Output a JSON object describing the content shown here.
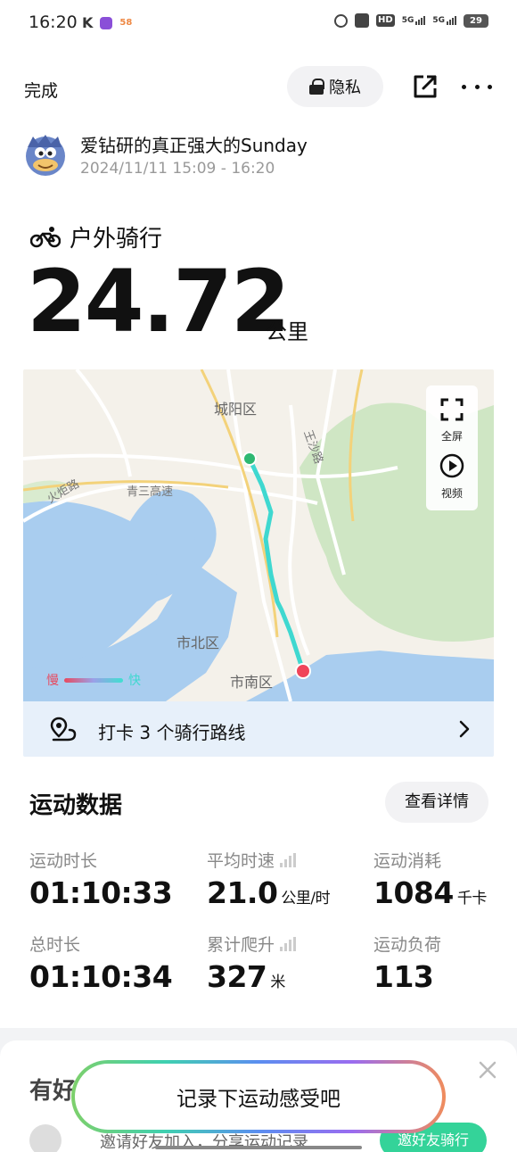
{
  "status_bar": {
    "time": "16:20",
    "left_icons": [
      "k-icon",
      "app-icon-1",
      "app-icon-2"
    ],
    "right_icons": [
      "alarm-icon",
      "id-icon",
      "hd-icon",
      "signal-5g-icon",
      "signal-5g-icon"
    ],
    "hd_label": "HD",
    "net1": "5G",
    "net2": "5G",
    "battery": "29"
  },
  "header": {
    "done_label": "完成",
    "privacy_label": "隐私",
    "share_icon": "share-icon",
    "more_icon": "more-icon"
  },
  "user": {
    "name": "爱钻研的真正强大的Sunday",
    "datetime": "2024/11/11 15:09 - 16:20",
    "avatar_icon": "avatar-icon"
  },
  "activity": {
    "type_icon": "bike-icon",
    "type_label": "户外骑行",
    "distance": "24.72",
    "distance_unit": "公里"
  },
  "map": {
    "labels": {
      "chengyang": "城阳区",
      "wangsha": "王沙路",
      "huoju": "火炬路",
      "qingsan": "青三高速",
      "shibei": "市北区",
      "shinan": "市南区"
    },
    "fullscreen_label": "全屏",
    "video_label": "视频",
    "legend_slow": "慢",
    "legend_fast": "快",
    "route_text": "打卡 3 个骑行路线",
    "colors": {
      "water": "#a9cdef",
      "land": "#f4f1ea",
      "green": "#cfe6c4",
      "route": "#3fd8d0",
      "start": "#2eb872",
      "end": "#f0455a"
    }
  },
  "stats": {
    "title": "运动数据",
    "detail_label": "查看详情",
    "items": [
      {
        "label": "运动时长",
        "value": "01:10:33",
        "unit": ""
      },
      {
        "label": "平均时速",
        "value": "21.0",
        "unit": "公里/时"
      },
      {
        "label": "运动消耗",
        "value": "1084",
        "unit": "千卡"
      },
      {
        "label": "总时长",
        "value": "01:10:34",
        "unit": ""
      },
      {
        "label": "累计爬升",
        "value": "327",
        "unit": "米"
      },
      {
        "label": "运动负荷",
        "value": "113",
        "unit": ""
      }
    ]
  },
  "lower": {
    "title": "有好",
    "invite_text": "邀请好友加入，分享运动记录",
    "invite_btn": "邀好友骑行"
  },
  "feel_button": "记录下运动感受吧"
}
